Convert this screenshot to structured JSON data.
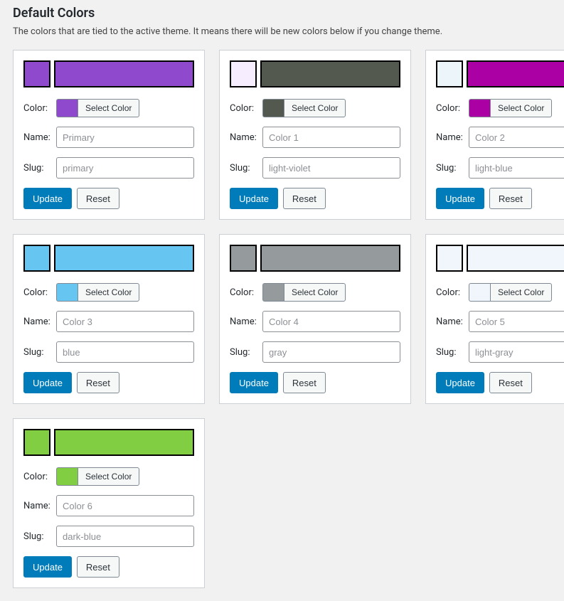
{
  "header": {
    "title": "Default Colors",
    "description": "The colors that are tied to the active theme. It means there will be new colors below if you change theme."
  },
  "labels": {
    "color": "Color:",
    "name": "Name:",
    "slug": "Slug:",
    "select_color": "Select Color",
    "update": "Update",
    "reset": "Reset"
  },
  "cards": [
    {
      "preview_small": "#8e49cc",
      "preview_large": "#8e49cc",
      "swatch": "#8e49cc",
      "name_placeholder": "Primary",
      "slug_placeholder": "primary"
    },
    {
      "preview_small": "#f6edfe",
      "preview_large": "#545950",
      "swatch": "#545950",
      "name_placeholder": "Color 1",
      "slug_placeholder": "light-violet"
    },
    {
      "preview_small": "#ecf5fa",
      "preview_large": "#ab00a3",
      "swatch": "#ab00a3",
      "name_placeholder": "Color 2",
      "slug_placeholder": "light-blue"
    },
    {
      "preview_small": "#67c5f2",
      "preview_large": "#67c5f2",
      "swatch": "#67c5f2",
      "name_placeholder": "Color 3",
      "slug_placeholder": "blue"
    },
    {
      "preview_small": "#959a9d",
      "preview_large": "#959a9d",
      "swatch": "#959a9d",
      "name_placeholder": "Color 4",
      "slug_placeholder": "gray"
    },
    {
      "preview_small": "#f0f6fb",
      "preview_large": "#f0f6fb",
      "swatch": "#f0f6fb",
      "name_placeholder": "Color 5",
      "slug_placeholder": "light-gray"
    },
    {
      "preview_small": "#82ce43",
      "preview_large": "#82ce43",
      "swatch": "#82ce43",
      "name_placeholder": "Color 6",
      "slug_placeholder": "dark-blue"
    }
  ]
}
